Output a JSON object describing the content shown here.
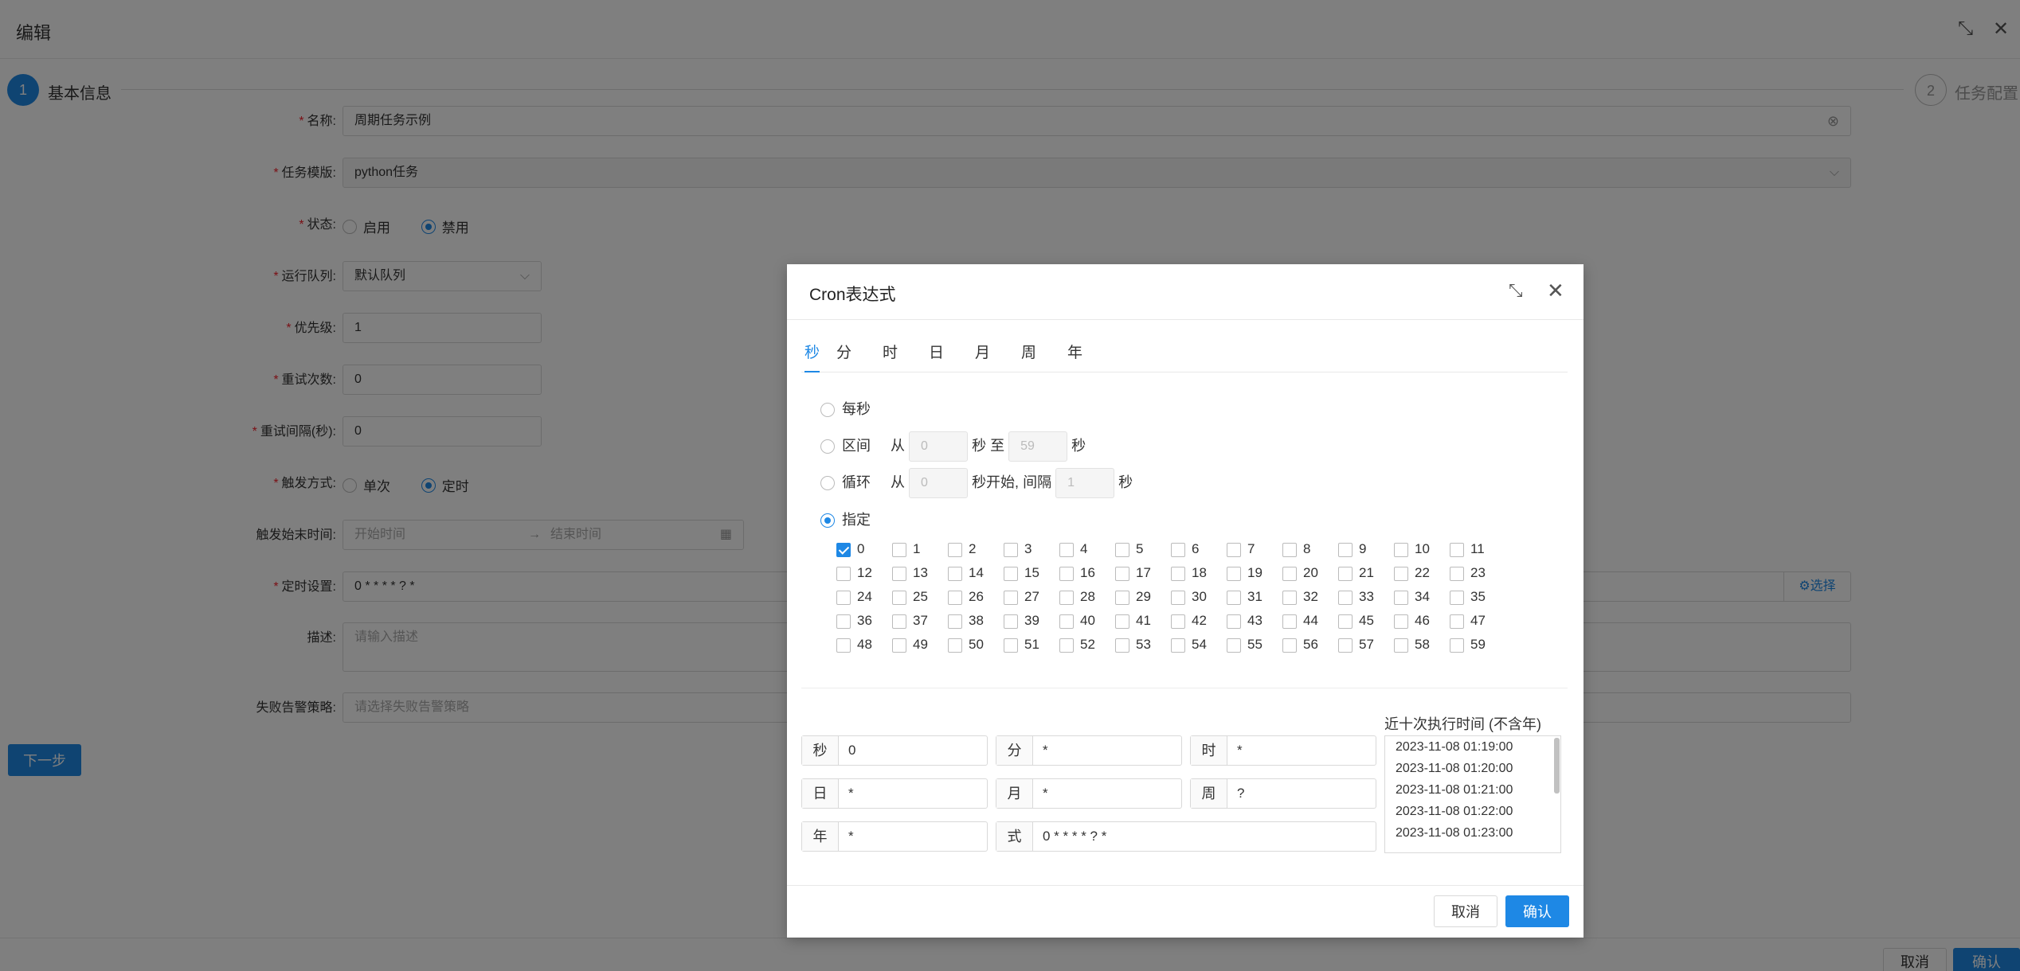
{
  "page": {
    "title": "编辑",
    "steps": [
      {
        "num": "1",
        "label": "基本信息"
      },
      {
        "num": "2",
        "label": "任务配置"
      }
    ],
    "form": {
      "name": {
        "label": "名称:",
        "value": "周期任务示例"
      },
      "template": {
        "label": "任务模版:",
        "value": "python任务"
      },
      "status": {
        "label": "状态:",
        "options": [
          "启用",
          "禁用"
        ],
        "selected": "禁用"
      },
      "queue": {
        "label": "运行队列:",
        "value": "默认队列"
      },
      "priority": {
        "label": "优先级:",
        "value": "1"
      },
      "retry_count": {
        "label": "重试次数:",
        "value": "0"
      },
      "retry_interval": {
        "label": "重试间隔(秒):",
        "value": "0"
      },
      "trigger_mode": {
        "label": "触发方式:",
        "options": [
          "单次",
          "定时"
        ],
        "selected": "定时"
      },
      "trigger_time": {
        "label": "触发始末时间:",
        "start_placeholder": "开始时间",
        "arrow": "→",
        "end_placeholder": "结束时间"
      },
      "schedule": {
        "label": "定时设置:",
        "value": "0 * * * * ? *",
        "select_label": "选择"
      },
      "description": {
        "label": "描述:",
        "placeholder": "请输入描述"
      },
      "alert": {
        "label": "失败告警策略:",
        "placeholder": "请选择失败告警策略"
      }
    },
    "next_button": "下一步",
    "footer": {
      "cancel": "取消",
      "confirm": "确认"
    }
  },
  "dialog": {
    "title": "Cron表达式",
    "tabs": [
      "秒",
      "分",
      "时",
      "日",
      "月",
      "周",
      "年"
    ],
    "active_tab": "秒",
    "modes": {
      "every": {
        "label": "每秒"
      },
      "range": {
        "label": "区间",
        "from": "从",
        "from_value": "0",
        "to": "秒 至",
        "to_value": "59",
        "unit": "秒"
      },
      "loop": {
        "label": "循环",
        "from": "从",
        "start_value": "0",
        "start_suffix": "秒开始, 间隔",
        "interval_value": "1",
        "unit": "秒"
      },
      "specify": {
        "label": "指定"
      }
    },
    "selected_mode": "specify",
    "seconds_checked": [
      0
    ],
    "fields": {
      "second": {
        "label": "秒",
        "value": "0"
      },
      "minute": {
        "label": "分",
        "value": "*"
      },
      "hour": {
        "label": "时",
        "value": "*"
      },
      "day": {
        "label": "日",
        "value": "*"
      },
      "month": {
        "label": "月",
        "value": "*"
      },
      "week": {
        "label": "周",
        "value": "?"
      },
      "year": {
        "label": "年",
        "value": "*"
      },
      "expression": {
        "label": "式",
        "value": "0 * * * * ? *"
      }
    },
    "recent_title": "近十次执行时间 (不含年)",
    "recent_runs": [
      "2023-11-08 01:19:00",
      "2023-11-08 01:20:00",
      "2023-11-08 01:21:00",
      "2023-11-08 01:22:00",
      "2023-11-08 01:23:00"
    ],
    "cancel": "取消",
    "confirm": "确认"
  },
  "icons": {
    "maximize": "maximize-icon",
    "close": "close-icon",
    "clear": "clear-icon",
    "dropdown": "chevron-down-icon",
    "calendar": "calendar-icon",
    "gear": "gear-icon"
  },
  "colors": {
    "primary": "#1e88e5",
    "required": "#f5222d",
    "overlay": "rgba(0,0,0,0.5)"
  }
}
